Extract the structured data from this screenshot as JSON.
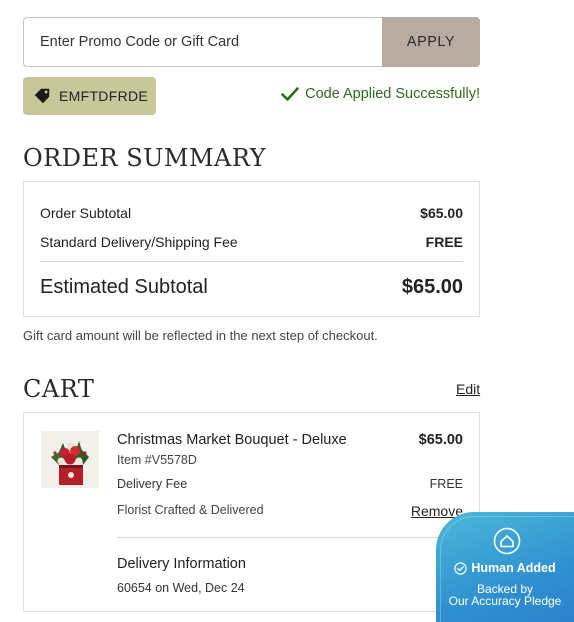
{
  "promo": {
    "placeholder": "Enter Promo Code or Gift Card",
    "value": "",
    "apply_label": "APPLY",
    "applied_code": "EMFTDFRDE",
    "success_message": "Code Applied Successfully!"
  },
  "colors": {
    "apply_button": "#b8aca2",
    "code_chip": "#c8c79a",
    "success": "#2e6b1e",
    "badge": "#3a9fd4"
  },
  "summary": {
    "title": "ORDER SUMMARY",
    "rows": [
      {
        "label": "Order Subtotal",
        "value": "$65.00"
      },
      {
        "label": "Standard Delivery/Shipping Fee",
        "value": "FREE"
      }
    ],
    "total_label": "Estimated Subtotal",
    "total_value": "$65.00",
    "note": "Gift card amount will be reflected in the next step of checkout."
  },
  "cart": {
    "title": "CART",
    "edit_label": "Edit",
    "item": {
      "name": "Christmas Market Bouquet - Deluxe",
      "price": "$65.00",
      "sku": "Item #V5578D",
      "fee_label": "Delivery Fee",
      "fee_value": "FREE",
      "crafted": "Florist Crafted & Delivered",
      "remove_label": "Remove",
      "thumb_icon": "bouquet-image"
    },
    "delivery": {
      "title": "Delivery Information",
      "detail": "60654 on Wed, Dec 24"
    }
  },
  "badge": {
    "headline": "Human Added",
    "line1": "Backed by",
    "line2": "Our Accuracy Pledge",
    "icon": "house-icon"
  }
}
